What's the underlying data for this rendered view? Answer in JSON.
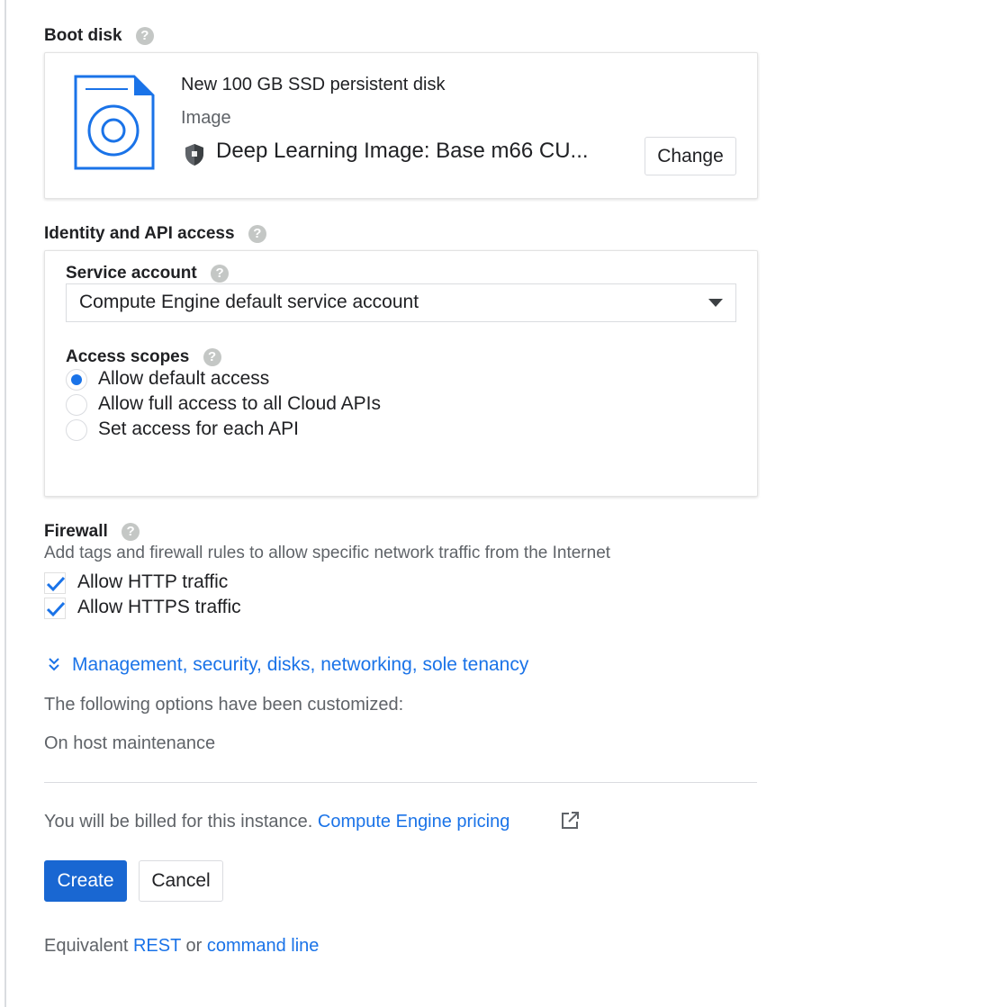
{
  "boot_disk": {
    "title": "Boot disk",
    "disk_name": "New 100 GB SSD persistent disk",
    "image_label": "Image",
    "image_name": "Deep Learning Image: Base m66 CU...",
    "change_button": "Change"
  },
  "identity": {
    "title": "Identity and API access",
    "service_account_label": "Service account",
    "service_account_value": "Compute Engine default service account",
    "access_scopes_label": "Access scopes",
    "scopes": [
      {
        "label": "Allow default access",
        "checked": true
      },
      {
        "label": "Allow full access to all Cloud APIs",
        "checked": false
      },
      {
        "label": "Set access for each API",
        "checked": false
      }
    ]
  },
  "firewall": {
    "title": "Firewall",
    "description": "Add tags and firewall rules to allow specific network traffic from the Internet",
    "options": [
      {
        "label": "Allow HTTP traffic",
        "checked": true
      },
      {
        "label": "Allow HTTPS traffic",
        "checked": true
      }
    ]
  },
  "advanced": {
    "expand_link": "Management, security, disks, networking, sole tenancy",
    "customized_text": "The following options have been customized:",
    "customized_item": "On host maintenance"
  },
  "billing": {
    "text": "You will be billed for this instance.",
    "pricing_link": "Compute Engine pricing"
  },
  "actions": {
    "create": "Create",
    "cancel": "Cancel"
  },
  "footer": {
    "prefix": "Equivalent",
    "rest_link": "REST",
    "or": "or",
    "cli_link": "command line"
  },
  "colors": {
    "accent": "#1a73e8",
    "primary_button": "#1967d2",
    "help_icon": "#c4c7c5"
  }
}
